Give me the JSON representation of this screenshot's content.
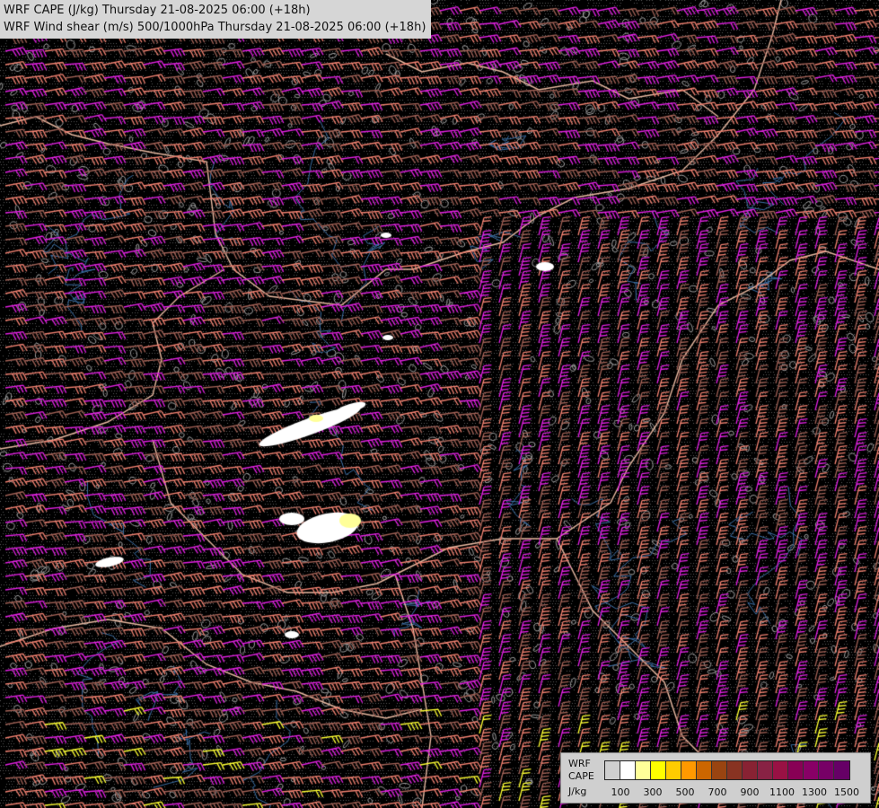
{
  "header": {
    "line1": "WRF CAPE (J/kg) Thursday 21-08-2025 06:00 (+18h)",
    "line2": "WRF Wind shear (m/s) 500/1000hPa Thursday 21-08-2025 06:00 (+18h)"
  },
  "legend": {
    "model_label": "WRF",
    "field_label": "CAPE",
    "unit_label": "J/kg",
    "colors": [
      "#cfcfcf",
      "#ffffff",
      "#ffff99",
      "#ffff00",
      "#ffcc00",
      "#ff9900",
      "#cc6600",
      "#994411",
      "#883322",
      "#882233",
      "#882244",
      "#991144",
      "#880055",
      "#880066",
      "#770066",
      "#660066"
    ],
    "ticks": [
      "100",
      "300",
      "500",
      "700",
      "900",
      "1100",
      "1300",
      "1500"
    ]
  },
  "map_colors": {
    "background": "#000000",
    "stipple": "#5a5a5a",
    "border": "#e8b8a0",
    "river": "#3a6ea5",
    "contour": "#a0a0a0",
    "barb_magenta": "#e020e0",
    "barb_salmon": "#f08070",
    "barb_brown": "#a06055",
    "barb_yellow": "#ffff33",
    "cape_white": "#ffffff",
    "cape_yellow": "#ffff99"
  }
}
